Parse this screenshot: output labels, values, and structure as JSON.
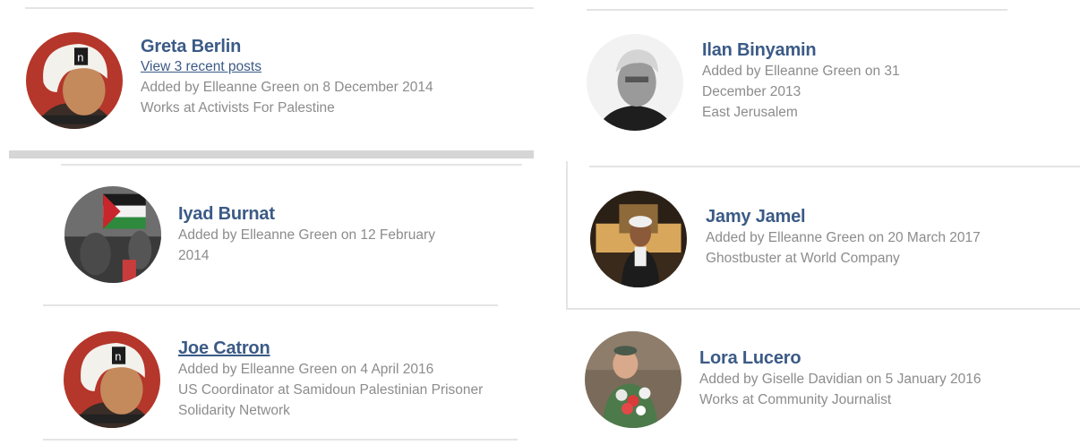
{
  "people": [
    {
      "name": "Greta Berlin",
      "posts_link": "View 3 recent posts",
      "added_line_1": "Added by Elleanne Green on 8 December 2014",
      "added_line_2": "",
      "work_line_1": "Works at Activists For Palestine",
      "work_line_2": "",
      "avatar": "activist-cartoon-avatar"
    },
    {
      "name": "Ilan Binyamin",
      "added_line_1": "Added by Elleanne Green on 31",
      "added_line_2": "December 2013",
      "work_line_1": "East Jerusalem",
      "work_line_2": "",
      "avatar": "bw-portrait-avatar"
    },
    {
      "name": "Iyad Burnat",
      "added_line_1": "Added by Elleanne Green on 12 February",
      "added_line_2": "2014",
      "work_line_1": "",
      "work_line_2": "",
      "avatar": "protest-flag-avatar"
    },
    {
      "name": "Jamy Jamel",
      "added_line_1": "Added by Elleanne Green on 20 March 2017",
      "added_line_2": "",
      "work_line_1": "Ghostbuster at World Company",
      "work_line_2": "",
      "avatar": "mosque-portrait-avatar"
    },
    {
      "name": "Joe Catron",
      "added_line_1": "Added by Elleanne Green on 4 April 2016",
      "added_line_2": "",
      "work_line_1": "US Coordinator at Samidoun Palestinian Prisoner",
      "work_line_2": "Solidarity Network",
      "avatar": "activist-cartoon-avatar"
    },
    {
      "name": "Lora Lucero",
      "added_line_1": "Added by Giselle Davidian on 5 January 2016",
      "added_line_2": "",
      "work_line_1": "Works at Community Journalist",
      "work_line_2": "",
      "avatar": "flowers-portrait-avatar"
    }
  ],
  "colors": {
    "name_link": "#3b5a86",
    "meta_text": "#8c8c8c",
    "divider": "#e4e4e4"
  }
}
